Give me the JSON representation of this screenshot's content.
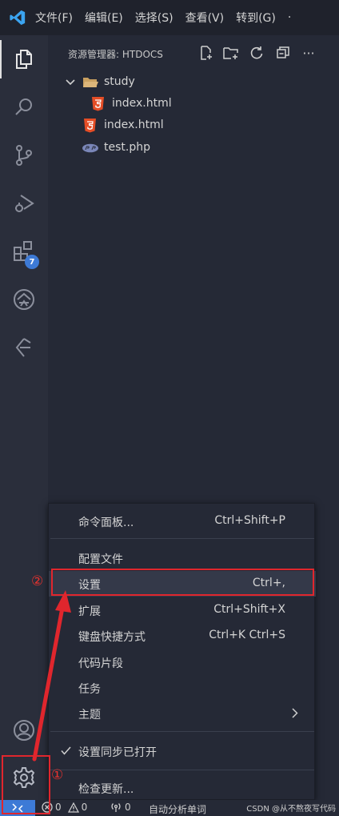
{
  "menubar": {
    "items": [
      "文件(F)",
      "编辑(E)",
      "选择(S)",
      "查看(V)",
      "转到(G)"
    ],
    "more": "·"
  },
  "activity_bar": {
    "extensions_badge": "7"
  },
  "explorer": {
    "title": "资源管理器: HTDOCS",
    "tree": [
      {
        "label": "study",
        "kind": "folder"
      },
      {
        "label": "index.html",
        "kind": "html"
      },
      {
        "label": "index.html",
        "kind": "html"
      },
      {
        "label": "test.php",
        "kind": "php"
      }
    ]
  },
  "context_menu": {
    "items": [
      {
        "label": "命令面板...",
        "shortcut": "Ctrl+Shift+P"
      },
      {
        "label": "配置文件",
        "shortcut": ""
      },
      {
        "label": "设置",
        "shortcut": "Ctrl+,"
      },
      {
        "label": "扩展",
        "shortcut": "Ctrl+Shift+X"
      },
      {
        "label": "键盘快捷方式",
        "shortcut": "Ctrl+K Ctrl+S"
      },
      {
        "label": "代码片段",
        "shortcut": ""
      },
      {
        "label": "任务",
        "shortcut": ""
      },
      {
        "label": "主题",
        "shortcut": ""
      },
      {
        "label": "设置同步已打开",
        "shortcut": ""
      },
      {
        "label": "检查更新...",
        "shortcut": ""
      }
    ]
  },
  "statusbar": {
    "errors": "0",
    "warnings": "0",
    "ports": "0",
    "text": "自动分析单词"
  },
  "annotations": {
    "one": "①",
    "two": "②"
  },
  "watermark": "CSDN @从不熬夜写代码",
  "colors": {
    "accent": "#3d7ad6",
    "annotation": "#e0262d",
    "html_icon": "#e44d26",
    "folder": "#dcb67a"
  }
}
